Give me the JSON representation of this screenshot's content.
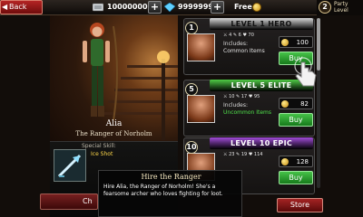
{
  "topbar": {
    "back_label": "Back",
    "gold": "10000000",
    "gems": "9999999",
    "free_label": "Free",
    "party_level_number": "2",
    "party_level_label": "Party Level"
  },
  "hero": {
    "name": "Alia",
    "title": "The Ranger of Norholm",
    "skill_label": "Special Skill:",
    "skill_value": "Ice Shot"
  },
  "cards": [
    {
      "header": "LEVEL 1 HERO",
      "header_color": "#d9d9d9",
      "level": "1",
      "stats": [
        "4",
        "6",
        "70"
      ],
      "includes": "Includes:",
      "items": "Common Items",
      "items_color": "#e0e0e0",
      "price": "100",
      "buy_label": "Buy"
    },
    {
      "header": "LEVEL 5 ELITE",
      "header_color": "#4fcb46",
      "level": "5",
      "stats": [
        "10",
        "17",
        "95"
      ],
      "includes": "Includes:",
      "items": "Uncommon Items",
      "items_color": "#4fe04a",
      "price": "82",
      "buy_label": "Buy"
    },
    {
      "header": "LEVEL 10 EPIC",
      "header_color": "#a14cd9",
      "level": "10",
      "stats": [
        "23",
        "19",
        "114"
      ],
      "price": "128",
      "buy_label": "Buy"
    }
  ],
  "tooltip": {
    "title": "Hire the Ranger",
    "body": "Hire Alia, the Ranger of Norholm! She's a fearsome archer who loves fighting for loot."
  },
  "bottom": {
    "left_button_label": "Ch",
    "store_label": "Store"
  }
}
